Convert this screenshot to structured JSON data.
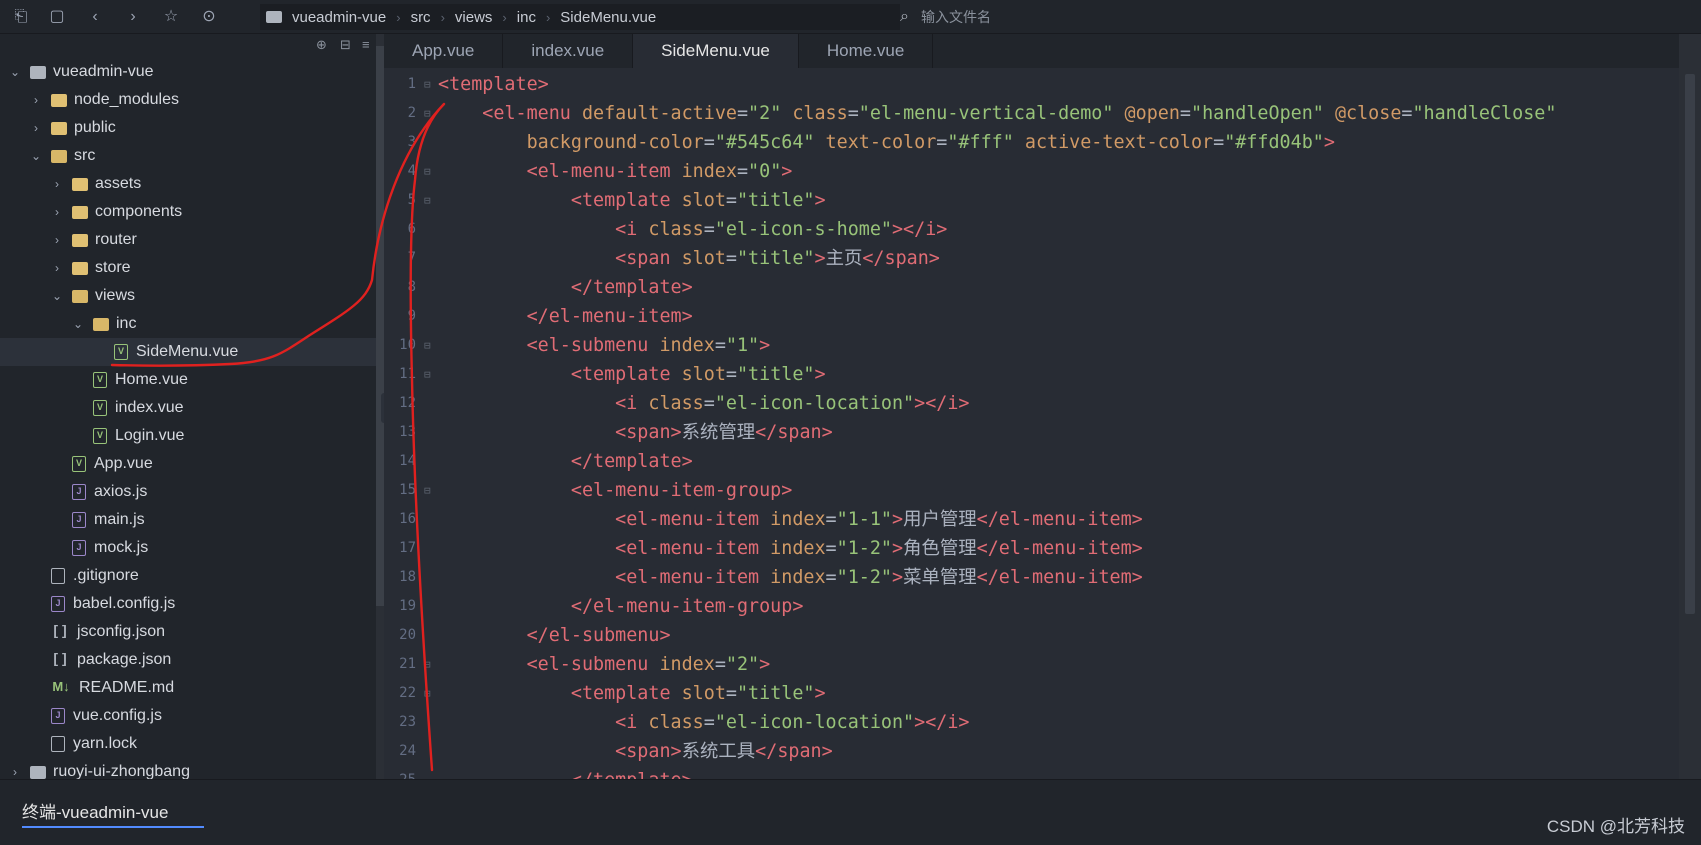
{
  "breadcrumb": [
    "vueadmin-vue",
    "src",
    "views",
    "inc",
    "SideMenu.vue"
  ],
  "search_placeholder": "输入文件名",
  "tree": [
    {
      "label": "vueadmin-vue",
      "depth": 0,
      "kind": "root",
      "chev": "⌄"
    },
    {
      "label": "node_modules",
      "depth": 1,
      "kind": "folder",
      "chev": "›"
    },
    {
      "label": "public",
      "depth": 1,
      "kind": "folder",
      "chev": "›"
    },
    {
      "label": "src",
      "depth": 1,
      "kind": "folder-open",
      "chev": "⌄"
    },
    {
      "label": "assets",
      "depth": 2,
      "kind": "folder",
      "chev": "›"
    },
    {
      "label": "components",
      "depth": 2,
      "kind": "folder",
      "chev": "›"
    },
    {
      "label": "router",
      "depth": 2,
      "kind": "folder",
      "chev": "›"
    },
    {
      "label": "store",
      "depth": 2,
      "kind": "folder",
      "chev": "›"
    },
    {
      "label": "views",
      "depth": 2,
      "kind": "folder-open",
      "chev": "⌄"
    },
    {
      "label": "inc",
      "depth": 3,
      "kind": "folder-open",
      "chev": "⌄"
    },
    {
      "label": "SideMenu.vue",
      "depth": 4,
      "kind": "vue",
      "selected": true
    },
    {
      "label": "Home.vue",
      "depth": 3,
      "kind": "vue"
    },
    {
      "label": "index.vue",
      "depth": 3,
      "kind": "vue"
    },
    {
      "label": "Login.vue",
      "depth": 3,
      "kind": "vue"
    },
    {
      "label": "App.vue",
      "depth": 2,
      "kind": "vue"
    },
    {
      "label": "axios.js",
      "depth": 2,
      "kind": "js"
    },
    {
      "label": "main.js",
      "depth": 2,
      "kind": "js"
    },
    {
      "label": "mock.js",
      "depth": 2,
      "kind": "js"
    },
    {
      "label": ".gitignore",
      "depth": 1,
      "kind": "gen"
    },
    {
      "label": "babel.config.js",
      "depth": 1,
      "kind": "js"
    },
    {
      "label": "jsconfig.json",
      "depth": 1,
      "kind": "json"
    },
    {
      "label": "package.json",
      "depth": 1,
      "kind": "json"
    },
    {
      "label": "README.md",
      "depth": 1,
      "kind": "md"
    },
    {
      "label": "vue.config.js",
      "depth": 1,
      "kind": "js"
    },
    {
      "label": "yarn.lock",
      "depth": 1,
      "kind": "gen"
    },
    {
      "label": "ruoyi-ui-zhongbang",
      "depth": 0,
      "kind": "root",
      "chev": "›"
    }
  ],
  "tabs": [
    {
      "label": "App.vue",
      "active": false
    },
    {
      "label": "index.vue",
      "active": false
    },
    {
      "label": "SideMenu.vue",
      "active": true
    },
    {
      "label": "Home.vue",
      "active": false
    }
  ],
  "code_lines": [
    [
      [
        "tag",
        "<template>"
      ]
    ],
    [
      [
        "pun",
        "    "
      ],
      [
        "tag",
        "<el-menu "
      ],
      [
        "attr",
        "default-active"
      ],
      [
        "pun",
        "="
      ],
      [
        "str",
        "\"2\""
      ],
      [
        "pun",
        " "
      ],
      [
        "attr",
        "class"
      ],
      [
        "pun",
        "="
      ],
      [
        "str",
        "\"el-menu-vertical-demo\""
      ],
      [
        "pun",
        " "
      ],
      [
        "attr",
        "@open"
      ],
      [
        "pun",
        "="
      ],
      [
        "str",
        "\"handleOpen\""
      ],
      [
        "pun",
        " "
      ],
      [
        "attr",
        "@close"
      ],
      [
        "pun",
        "="
      ],
      [
        "str",
        "\"handleClose\""
      ]
    ],
    [
      [
        "pun",
        "        "
      ],
      [
        "attr",
        "background-color"
      ],
      [
        "pun",
        "="
      ],
      [
        "str",
        "\"#545c64\""
      ],
      [
        "pun",
        " "
      ],
      [
        "attr",
        "text-color"
      ],
      [
        "pun",
        "="
      ],
      [
        "str",
        "\"#fff\""
      ],
      [
        "pun",
        " "
      ],
      [
        "attr",
        "active-text-color"
      ],
      [
        "pun",
        "="
      ],
      [
        "str",
        "\"#ffd04b\""
      ],
      [
        "tag",
        ">"
      ]
    ],
    [
      [
        "pun",
        "        "
      ],
      [
        "tag",
        "<el-menu-item "
      ],
      [
        "attr",
        "index"
      ],
      [
        "pun",
        "="
      ],
      [
        "str",
        "\"0\""
      ],
      [
        "tag",
        ">"
      ]
    ],
    [
      [
        "pun",
        "            "
      ],
      [
        "tag",
        "<template "
      ],
      [
        "attr",
        "slot"
      ],
      [
        "pun",
        "="
      ],
      [
        "str",
        "\"title\""
      ],
      [
        "tag",
        ">"
      ]
    ],
    [
      [
        "pun",
        "                "
      ],
      [
        "tag",
        "<i "
      ],
      [
        "attr",
        "class"
      ],
      [
        "pun",
        "="
      ],
      [
        "str",
        "\"el-icon-s-home\""
      ],
      [
        "tag",
        "></i>"
      ]
    ],
    [
      [
        "pun",
        "                "
      ],
      [
        "tag",
        "<span "
      ],
      [
        "attr",
        "slot"
      ],
      [
        "pun",
        "="
      ],
      [
        "str",
        "\"title\""
      ],
      [
        "tag",
        ">"
      ],
      [
        "txt",
        "主页"
      ],
      [
        "tag",
        "</span>"
      ]
    ],
    [
      [
        "pun",
        "            "
      ],
      [
        "tag",
        "</template>"
      ]
    ],
    [
      [
        "pun",
        "        "
      ],
      [
        "tag",
        "</el-menu-item>"
      ]
    ],
    [
      [
        "pun",
        "        "
      ],
      [
        "tag",
        "<el-submenu "
      ],
      [
        "attr",
        "index"
      ],
      [
        "pun",
        "="
      ],
      [
        "str",
        "\"1\""
      ],
      [
        "tag",
        ">"
      ]
    ],
    [
      [
        "pun",
        "            "
      ],
      [
        "tag",
        "<template "
      ],
      [
        "attr",
        "slot"
      ],
      [
        "pun",
        "="
      ],
      [
        "str",
        "\"title\""
      ],
      [
        "tag",
        ">"
      ]
    ],
    [
      [
        "pun",
        "                "
      ],
      [
        "tag",
        "<i "
      ],
      [
        "attr",
        "class"
      ],
      [
        "pun",
        "="
      ],
      [
        "str",
        "\"el-icon-location\""
      ],
      [
        "tag",
        "></i>"
      ]
    ],
    [
      [
        "pun",
        "                "
      ],
      [
        "tag",
        "<span>"
      ],
      [
        "txt",
        "系统管理"
      ],
      [
        "tag",
        "</span>"
      ]
    ],
    [
      [
        "pun",
        "            "
      ],
      [
        "tag",
        "</template>"
      ]
    ],
    [
      [
        "pun",
        "            "
      ],
      [
        "tag",
        "<el-menu-item-group>"
      ]
    ],
    [
      [
        "pun",
        "                "
      ],
      [
        "tag",
        "<el-menu-item "
      ],
      [
        "attr",
        "index"
      ],
      [
        "pun",
        "="
      ],
      [
        "str",
        "\"1-1\""
      ],
      [
        "tag",
        ">"
      ],
      [
        "txt",
        "用户管理"
      ],
      [
        "tag",
        "</el-menu-item>"
      ]
    ],
    [
      [
        "pun",
        "                "
      ],
      [
        "tag",
        "<el-menu-item "
      ],
      [
        "attr",
        "index"
      ],
      [
        "pun",
        "="
      ],
      [
        "str",
        "\"1-2\""
      ],
      [
        "tag",
        ">"
      ],
      [
        "txt",
        "角色管理"
      ],
      [
        "tag",
        "</el-menu-item>"
      ]
    ],
    [
      [
        "pun",
        "                "
      ],
      [
        "tag",
        "<el-menu-item "
      ],
      [
        "attr",
        "index"
      ],
      [
        "pun",
        "="
      ],
      [
        "str",
        "\"1-2\""
      ],
      [
        "tag",
        ">"
      ],
      [
        "txt",
        "菜单管理"
      ],
      [
        "tag",
        "</el-menu-item>"
      ]
    ],
    [
      [
        "pun",
        "            "
      ],
      [
        "tag",
        "</el-menu-item-group>"
      ]
    ],
    [
      [
        "pun",
        "        "
      ],
      [
        "tag",
        "</el-submenu>"
      ]
    ],
    [
      [
        "pun",
        "        "
      ],
      [
        "tag",
        "<el-submenu "
      ],
      [
        "attr",
        "index"
      ],
      [
        "pun",
        "="
      ],
      [
        "str",
        "\"2\""
      ],
      [
        "tag",
        ">"
      ]
    ],
    [
      [
        "pun",
        "            "
      ],
      [
        "tag",
        "<template "
      ],
      [
        "attr",
        "slot"
      ],
      [
        "pun",
        "="
      ],
      [
        "str",
        "\"title\""
      ],
      [
        "tag",
        ">"
      ]
    ],
    [
      [
        "pun",
        "                "
      ],
      [
        "tag",
        "<i "
      ],
      [
        "attr",
        "class"
      ],
      [
        "pun",
        "="
      ],
      [
        "str",
        "\"el-icon-location\""
      ],
      [
        "tag",
        "></i>"
      ]
    ],
    [
      [
        "pun",
        "                "
      ],
      [
        "tag",
        "<span>"
      ],
      [
        "txt",
        "系统工具"
      ],
      [
        "tag",
        "</span>"
      ]
    ],
    [
      [
        "pun",
        "            "
      ],
      [
        "tag",
        "</template>"
      ]
    ]
  ],
  "foldable_lines": [
    1,
    2,
    4,
    5,
    10,
    11,
    15,
    21,
    22
  ],
  "terminal_tab": "终端-vueadmin-vue",
  "watermark": "CSDN @北芳科技",
  "colors": {
    "tag": "#e06c75",
    "attr": "#d19a66",
    "str": "#98c379",
    "annotation": "#e0211f"
  }
}
